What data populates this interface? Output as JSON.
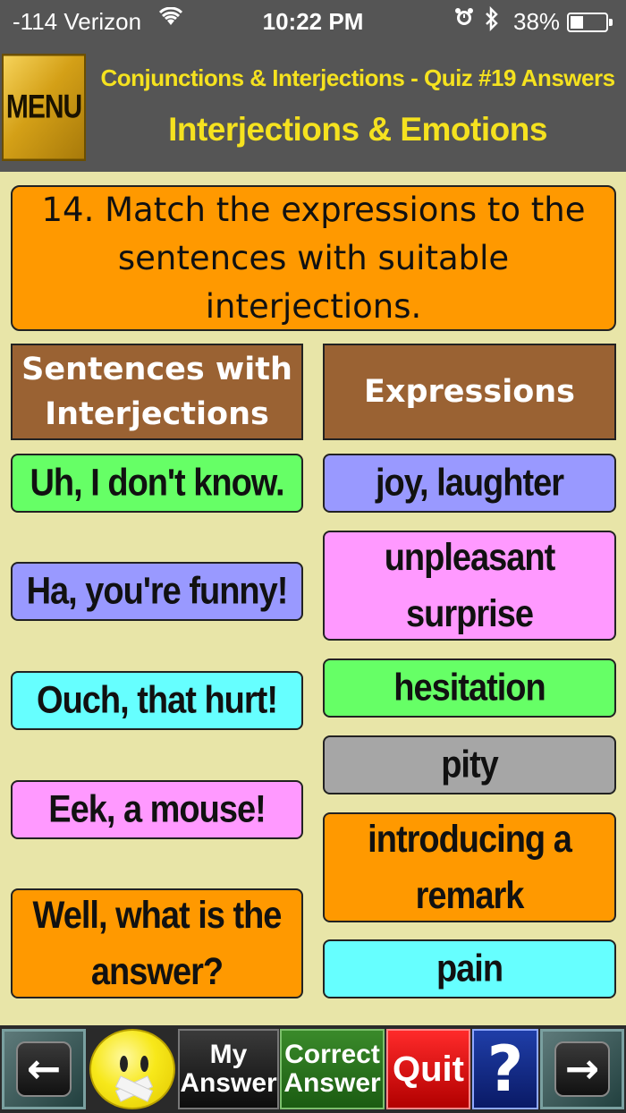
{
  "status_bar": {
    "carrier": "-114 Verizon",
    "time": "10:22 PM",
    "battery_percent": "38%",
    "battery_level": 0.38,
    "icons": [
      "wifi-icon",
      "alarm-icon",
      "bluetooth-icon",
      "battery-icon"
    ]
  },
  "header": {
    "menu_label": "MENU",
    "title": "Conjunctions & Interjections - Quiz #19 Answers",
    "subtitle": "Interjections & Emotions",
    "background_color": "#555555",
    "text_color": "#f5e21f"
  },
  "question": {
    "text": "14. Match the expressions to the sentences with suitable interjections.",
    "color": "#ff9900"
  },
  "columns": {
    "left_header": "Sentences with Interjections",
    "right_header": "Expressions",
    "header_color": "#9a6233"
  },
  "sentences": [
    {
      "text": "Uh, I don't know.",
      "color": "#66ff66"
    },
    {
      "text": "Ha, you're funny!",
      "color": "#9999ff"
    },
    {
      "text": "Ouch, that hurt!",
      "color": "#66ffff"
    },
    {
      "text": "Eek, a mouse!",
      "color": "#ff99ff"
    },
    {
      "text": "Well, what is the answer?",
      "color": "#ff9900"
    }
  ],
  "expressions": [
    {
      "text": "joy, laughter",
      "color": "#9999ff"
    },
    {
      "text": "unpleasant surprise",
      "color": "#ff99ff"
    },
    {
      "text": "hesitation",
      "color": "#66ff66"
    },
    {
      "text": "pity",
      "color": "#a6a6a6"
    },
    {
      "text": "introducing a remark",
      "color": "#ff9900"
    },
    {
      "text": "pain",
      "color": "#66ffff"
    }
  ],
  "toolbar": {
    "back_icon": "←",
    "next_icon": "→",
    "my_answer_label": "My Answer",
    "correct_answer_label": "Correct Answer",
    "quit_label": "Quit",
    "help_label": "?",
    "emoji_icon": "taped-mouth-smiley-icon"
  }
}
